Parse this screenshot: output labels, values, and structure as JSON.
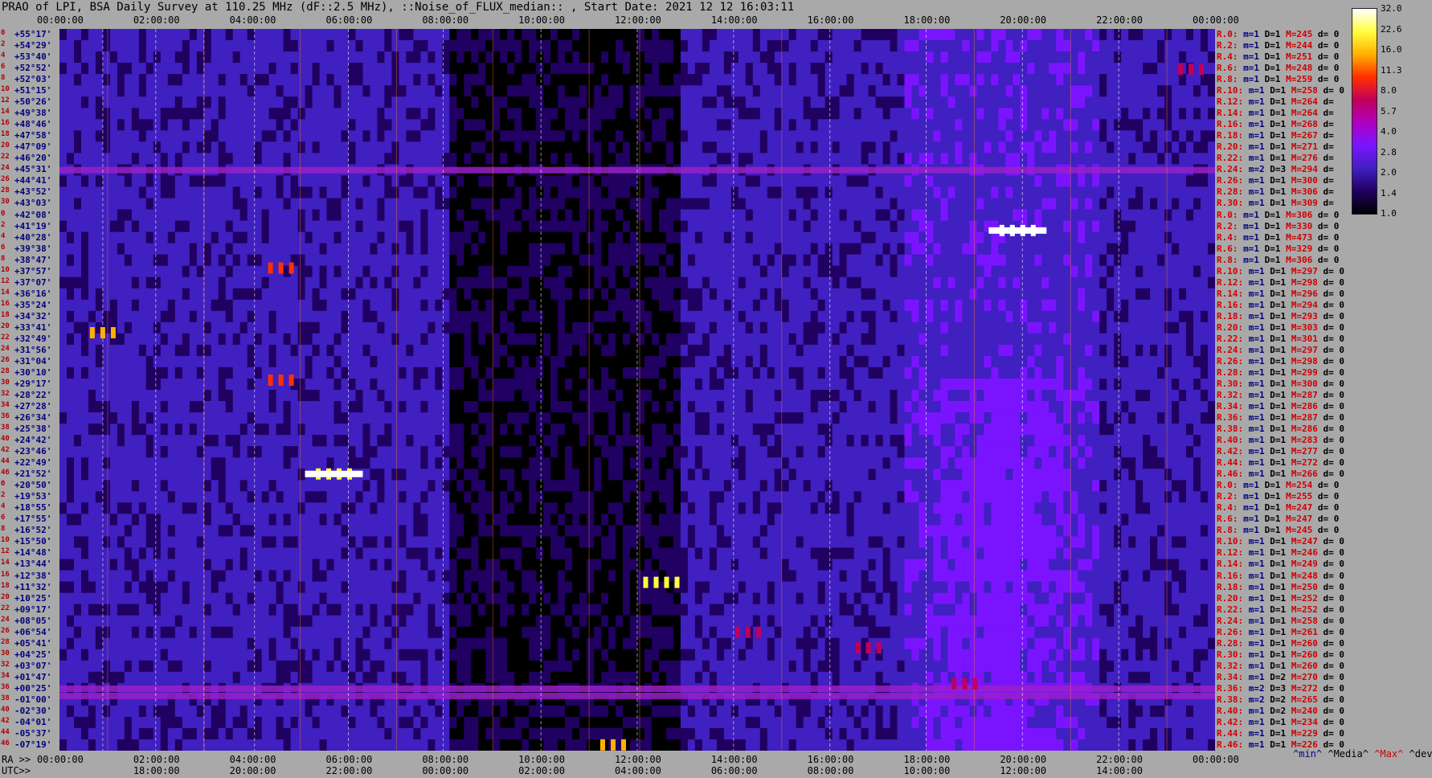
{
  "title": "PRAO of LPI, BSA Daily Survey at 110.25 MHz (dF::2.5 MHz), ::Noise_of_FLUX_median:: , Start Date: 2021 12 12 16:03:11",
  "top_ticks": [
    "00:00:00",
    "02:00:00",
    "04:00:00",
    "06:00:00",
    "08:00:00",
    "10:00:00",
    "12:00:00",
    "14:00:00",
    "16:00:00",
    "18:00:00",
    "20:00:00",
    "22:00:00",
    "00:00:00"
  ],
  "ra_label": "RA >>",
  "ra_ticks": [
    "00:00:00",
    "02:00:00",
    "04:00:00",
    "06:00:00",
    "08:00:00",
    "10:00:00",
    "12:00:00",
    "14:00:00",
    "16:00:00",
    "18:00:00",
    "20:00:00",
    "22:00:00",
    "00:00:00"
  ],
  "utc_label": "UTC>>",
  "utc_ticks": [
    "18:00:00",
    "20:00:00",
    "22:00:00",
    "00:00:00",
    "02:00:00",
    "04:00:00",
    "06:00:00",
    "08:00:00",
    "10:00:00",
    "12:00:00",
    "14:00:00"
  ],
  "dec_labels": [
    "+55°17'",
    "+54°29'",
    "+53°40'",
    "+52°52'",
    "+52°03'",
    "+51°15'",
    "+50°26'",
    "+49°38'",
    "+48°46'",
    "+47°58'",
    "+47°09'",
    "+46°20'",
    "+45°31'",
    "+44°41'",
    "+43°52'",
    "+43°03'",
    "+42°08'",
    "+41°19'",
    "+40°28'",
    "+39°38'",
    "+38°47'",
    "+37°57'",
    "+37°07'",
    "+36°16'",
    "+35°24'",
    "+34°32'",
    "+33°41'",
    "+32°49'",
    "+31°56'",
    "+31°04'",
    "+30°10'",
    "+29°17'",
    "+28°22'",
    "+27°28'",
    "+26°34'",
    "+25°38'",
    "+24°42'",
    "+23°46'",
    "+22°49'",
    "+21°52'",
    "+20°50'",
    "+19°53'",
    "+18°55'",
    "+17°55'",
    "+16°52'",
    "+15°50'",
    "+14°48'",
    "+13°44'",
    "+12°38'",
    "+11°32'",
    "+10°25'",
    "+09°17'",
    "+08°05'",
    "+06°54'",
    "+05°41'",
    "+04°25'",
    "+03°07'",
    "+01°47'",
    "+00°25'",
    "-01°00'",
    "-02°30'",
    "-04°01'",
    "-05°37'",
    "-07°19'"
  ],
  "row_stats": [
    {
      "r": "R.0:",
      "m": "m=1",
      "d": "D=1",
      "mx": "M=245",
      "dv": "d= 0"
    },
    {
      "r": "R.2:",
      "m": "m=1",
      "d": "D=1",
      "mx": "M=244",
      "dv": "d= 0"
    },
    {
      "r": "R.4:",
      "m": "m=1",
      "d": "D=1",
      "mx": "M=251",
      "dv": "d= 0"
    },
    {
      "r": "R.6:",
      "m": "m=1",
      "d": "D=1",
      "mx": "M=248",
      "dv": "d= 0"
    },
    {
      "r": "R.8:",
      "m": "m=1",
      "d": "D=1",
      "mx": "M=259",
      "dv": "d= 0"
    },
    {
      "r": "R.10:",
      "m": "m=1",
      "d": "D=1",
      "mx": "M=258",
      "dv": "d= 0"
    },
    {
      "r": "R.12:",
      "m": "m=1",
      "d": "D=1",
      "mx": "M=264",
      "dv": "d="
    },
    {
      "r": "R.14:",
      "m": "m=1",
      "d": "D=1",
      "mx": "M=264",
      "dv": "d="
    },
    {
      "r": "R.16:",
      "m": "m=1",
      "d": "D=1",
      "mx": "M=268",
      "dv": "d="
    },
    {
      "r": "R.18:",
      "m": "m=1",
      "d": "D=1",
      "mx": "M=267",
      "dv": "d="
    },
    {
      "r": "R.20:",
      "m": "m=1",
      "d": "D=1",
      "mx": "M=271",
      "dv": "d="
    },
    {
      "r": "R.22:",
      "m": "m=1",
      "d": "D=1",
      "mx": "M=276",
      "dv": "d="
    },
    {
      "r": "R.24:",
      "m": "m=2",
      "d": "D=3",
      "mx": "M=294",
      "dv": "d="
    },
    {
      "r": "R.26:",
      "m": "m=1",
      "d": "D=1",
      "mx": "M=300",
      "dv": "d="
    },
    {
      "r": "R.28:",
      "m": "m=1",
      "d": "D=1",
      "mx": "M=306",
      "dv": "d="
    },
    {
      "r": "R.30:",
      "m": "m=1",
      "d": "D=1",
      "mx": "M=309",
      "dv": "d="
    },
    {
      "r": "R.0:",
      "m": "m=1",
      "d": "D=1",
      "mx": "M=306",
      "dv": "d= 0"
    },
    {
      "r": "R.2:",
      "m": "m=1",
      "d": "D=1",
      "mx": "M=330",
      "dv": "d= 0"
    },
    {
      "r": "R.4:",
      "m": "m=1",
      "d": "D=1",
      "mx": "M=473",
      "dv": "d= 0"
    },
    {
      "r": "R.6:",
      "m": "m=1",
      "d": "D=1",
      "mx": "M=329",
      "dv": "d= 0"
    },
    {
      "r": "R.8:",
      "m": "m=1",
      "d": "D=1",
      "mx": "M=306",
      "dv": "d= 0"
    },
    {
      "r": "R.10:",
      "m": "m=1",
      "d": "D=1",
      "mx": "M=297",
      "dv": "d= 0"
    },
    {
      "r": "R.12:",
      "m": "m=1",
      "d": "D=1",
      "mx": "M=298",
      "dv": "d= 0"
    },
    {
      "r": "R.14:",
      "m": "m=1",
      "d": "D=1",
      "mx": "M=296",
      "dv": "d= 0"
    },
    {
      "r": "R.16:",
      "m": "m=1",
      "d": "D=1",
      "mx": "M=294",
      "dv": "d= 0"
    },
    {
      "r": "R.18:",
      "m": "m=1",
      "d": "D=1",
      "mx": "M=293",
      "dv": "d= 0"
    },
    {
      "r": "R.20:",
      "m": "m=1",
      "d": "D=1",
      "mx": "M=303",
      "dv": "d= 0"
    },
    {
      "r": "R.22:",
      "m": "m=1",
      "d": "D=1",
      "mx": "M=301",
      "dv": "d= 0"
    },
    {
      "r": "R.24:",
      "m": "m=1",
      "d": "D=1",
      "mx": "M=297",
      "dv": "d= 0"
    },
    {
      "r": "R.26:",
      "m": "m=1",
      "d": "D=1",
      "mx": "M=298",
      "dv": "d= 0"
    },
    {
      "r": "R.28:",
      "m": "m=1",
      "d": "D=1",
      "mx": "M=299",
      "dv": "d= 0"
    },
    {
      "r": "R.30:",
      "m": "m=1",
      "d": "D=1",
      "mx": "M=300",
      "dv": "d= 0"
    },
    {
      "r": "R.32:",
      "m": "m=1",
      "d": "D=1",
      "mx": "M=287",
      "dv": "d= 0"
    },
    {
      "r": "R.34:",
      "m": "m=1",
      "d": "D=1",
      "mx": "M=286",
      "dv": "d= 0"
    },
    {
      "r": "R.36:",
      "m": "m=1",
      "d": "D=1",
      "mx": "M=287",
      "dv": "d= 0"
    },
    {
      "r": "R.38:",
      "m": "m=1",
      "d": "D=1",
      "mx": "M=286",
      "dv": "d= 0"
    },
    {
      "r": "R.40:",
      "m": "m=1",
      "d": "D=1",
      "mx": "M=283",
      "dv": "d= 0"
    },
    {
      "r": "R.42:",
      "m": "m=1",
      "d": "D=1",
      "mx": "M=277",
      "dv": "d= 0"
    },
    {
      "r": "R.44:",
      "m": "m=1",
      "d": "D=1",
      "mx": "M=272",
      "dv": "d= 0"
    },
    {
      "r": "R.46:",
      "m": "m=1",
      "d": "D=1",
      "mx": "M=266",
      "dv": "d= 0"
    },
    {
      "r": "R.0:",
      "m": "m=1",
      "d": "D=1",
      "mx": "M=254",
      "dv": "d= 0"
    },
    {
      "r": "R.2:",
      "m": "m=1",
      "d": "D=1",
      "mx": "M=255",
      "dv": "d= 0"
    },
    {
      "r": "R.4:",
      "m": "m=1",
      "d": "D=1",
      "mx": "M=247",
      "dv": "d= 0"
    },
    {
      "r": "R.6:",
      "m": "m=1",
      "d": "D=1",
      "mx": "M=247",
      "dv": "d= 0"
    },
    {
      "r": "R.8:",
      "m": "m=1",
      "d": "D=1",
      "mx": "M=245",
      "dv": "d= 0"
    },
    {
      "r": "R.10:",
      "m": "m=1",
      "d": "D=1",
      "mx": "M=247",
      "dv": "d= 0"
    },
    {
      "r": "R.12:",
      "m": "m=1",
      "d": "D=1",
      "mx": "M=246",
      "dv": "d= 0"
    },
    {
      "r": "R.14:",
      "m": "m=1",
      "d": "D=1",
      "mx": "M=249",
      "dv": "d= 0"
    },
    {
      "r": "R.16:",
      "m": "m=1",
      "d": "D=1",
      "mx": "M=248",
      "dv": "d= 0"
    },
    {
      "r": "R.18:",
      "m": "m=1",
      "d": "D=1",
      "mx": "M=250",
      "dv": "d= 0"
    },
    {
      "r": "R.20:",
      "m": "m=1",
      "d": "D=1",
      "mx": "M=252",
      "dv": "d= 0"
    },
    {
      "r": "R.22:",
      "m": "m=1",
      "d": "D=1",
      "mx": "M=252",
      "dv": "d= 0"
    },
    {
      "r": "R.24:",
      "m": "m=1",
      "d": "D=1",
      "mx": "M=258",
      "dv": "d= 0"
    },
    {
      "r": "R.26:",
      "m": "m=1",
      "d": "D=1",
      "mx": "M=261",
      "dv": "d= 0"
    },
    {
      "r": "R.28:",
      "m": "m=1",
      "d": "D=1",
      "mx": "M=260",
      "dv": "d= 0"
    },
    {
      "r": "R.30:",
      "m": "m=1",
      "d": "D=1",
      "mx": "M=260",
      "dv": "d= 0"
    },
    {
      "r": "R.32:",
      "m": "m=1",
      "d": "D=1",
      "mx": "M=260",
      "dv": "d= 0"
    },
    {
      "r": "R.34:",
      "m": "m=1",
      "d": "D=2",
      "mx": "M=270",
      "dv": "d= 0"
    },
    {
      "r": "R.36:",
      "m": "m=2",
      "d": "D=3",
      "mx": "M=272",
      "dv": "d= 0"
    },
    {
      "r": "R.38:",
      "m": "m=2",
      "d": "D=2",
      "mx": "M=265",
      "dv": "d= 0"
    },
    {
      "r": "R.40:",
      "m": "m=1",
      "d": "D=2",
      "mx": "M=240",
      "dv": "d= 0"
    },
    {
      "r": "R.42:",
      "m": "m=1",
      "d": "D=1",
      "mx": "M=234",
      "dv": "d= 0"
    },
    {
      "r": "R.44:",
      "m": "m=1",
      "d": "D=1",
      "mx": "M=229",
      "dv": "d= 0"
    },
    {
      "r": "R.46:",
      "m": "m=1",
      "d": "D=1",
      "mx": "M=226",
      "dv": "d= 0"
    }
  ],
  "legend": {
    "min": "^min^",
    "median": "^Media^",
    "max": "^Max^",
    "dev": "^devia^"
  },
  "chart_data": {
    "type": "heatmap",
    "title": "PRAO of LPI, BSA Daily Survey at 110.25 MHz (dF::2.5 MHz), ::Noise_of_FLUX_median:: , Start Date: 2021 12 12 16:03:11",
    "x_axis_ra_hours": [
      0,
      24
    ],
    "colorbar_ticks": [
      32.0,
      22.6,
      16.0,
      11.3,
      8.0,
      5.7,
      4.0,
      2.8,
      2.0,
      1.4,
      1.0
    ],
    "colorbar_scale": "log",
    "colormap": [
      "#ffffff",
      "#ffff40",
      "#ffb000",
      "#ff3000",
      "#c0005a",
      "#b000c0",
      "#7a14ff",
      "#4020c0",
      "#200060",
      "#000000"
    ],
    "bright_sources": [
      {
        "ra_h": 19.9,
        "dec": 41.0,
        "level": 32
      },
      {
        "ra_h": 5.7,
        "dec": 21.9,
        "level": 26
      },
      {
        "ra_h": 0.9,
        "dec": 33.3,
        "level": 14
      },
      {
        "ra_h": 12.5,
        "dec": 12.0,
        "level": 22
      },
      {
        "ra_h": 11.5,
        "dec": -7.3,
        "level": 16
      },
      {
        "ra_h": 4.6,
        "dec": 38.2,
        "level": 9
      },
      {
        "ra_h": 4.6,
        "dec": 29.6,
        "level": 9
      },
      {
        "ra_h": 18.8,
        "dec": 1.0,
        "level": 8
      },
      {
        "ra_h": 14.3,
        "dec": 6.9,
        "level": 7
      },
      {
        "ra_h": 23.5,
        "dec": 52.8,
        "level": 8
      },
      {
        "ra_h": 16.8,
        "dec": 5.2,
        "level": 6
      }
    ],
    "enhanced_strips_dec": [
      45.5,
      0.4,
      -0.5
    ]
  }
}
